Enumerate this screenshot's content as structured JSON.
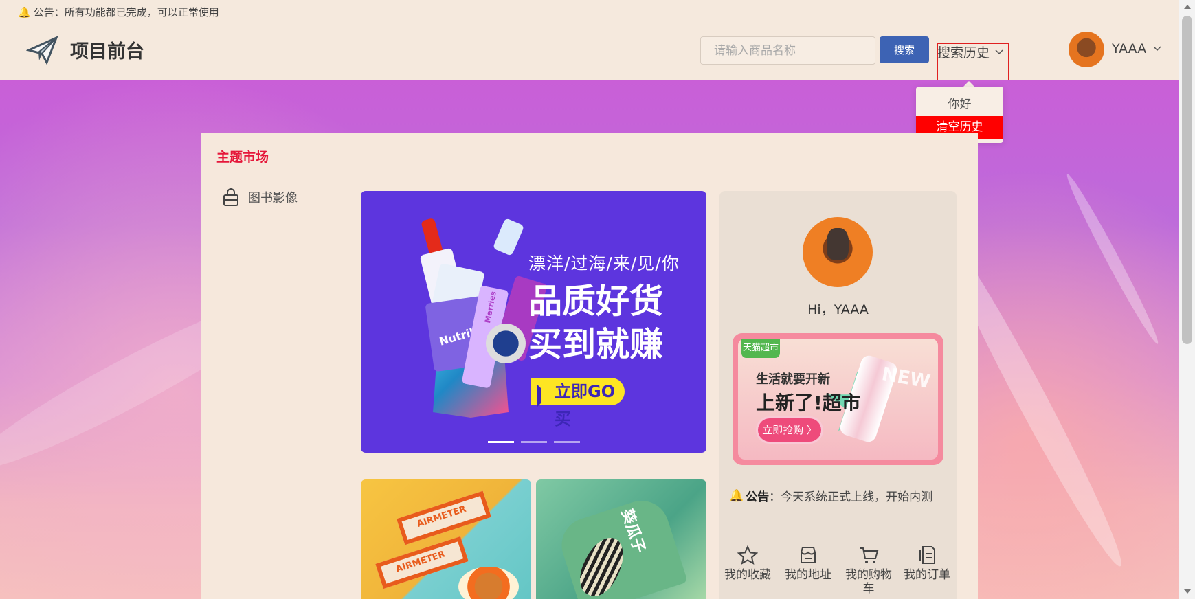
{
  "announcement": {
    "text": "公告：所有功能都已完成，可以正常使用",
    "icon": "bell-icon"
  },
  "header": {
    "site_title": "项目前台",
    "search_placeholder": "请输入商品名称",
    "search_button": "搜索",
    "history_label": "搜索历史",
    "username": "YAAA"
  },
  "history_dropdown": {
    "items": [
      {
        "label": "你好"
      },
      {
        "label": "清空历史"
      }
    ],
    "danger_color": "#ff0000"
  },
  "market": {
    "title": "主题市场",
    "categories": [
      {
        "label": "图书影像",
        "icon": "bag-icon"
      }
    ]
  },
  "carousel": {
    "headline": "漂洋/过海/来/见/你",
    "title_line1": "品质好货",
    "title_line2": "买到就赚",
    "button": "立即GO买",
    "product_label_1": "Nutrilon",
    "product_label_2": "Merries",
    "active_slide": 1,
    "slides_total": 3
  },
  "product_tiles": [
    {
      "label": "AIRMETER"
    },
    {
      "label": "葵瓜子"
    }
  ],
  "user_panel": {
    "greeting": "Hi，YAAA",
    "promo_tag": "天猫超市",
    "promo_line1": "生活就要开新",
    "promo_line2": "上新了!超市",
    "promo_button": "立即抢购 〉",
    "promo_badge": "NEW",
    "bulletin_label": "公告",
    "bulletin_text": "：今天系统正式上线，开始内测",
    "shortcuts": [
      {
        "label": "我的收藏",
        "icon": "star-icon"
      },
      {
        "label": "我的地址",
        "icon": "shop-icon"
      },
      {
        "label": "我的购物车",
        "icon": "cart-icon"
      },
      {
        "label": "我的订单",
        "icon": "document-icon"
      }
    ]
  },
  "colors": {
    "accent_red": "#e5173a",
    "search_blue": "#3d63b4",
    "background": "#f5e9dd"
  }
}
